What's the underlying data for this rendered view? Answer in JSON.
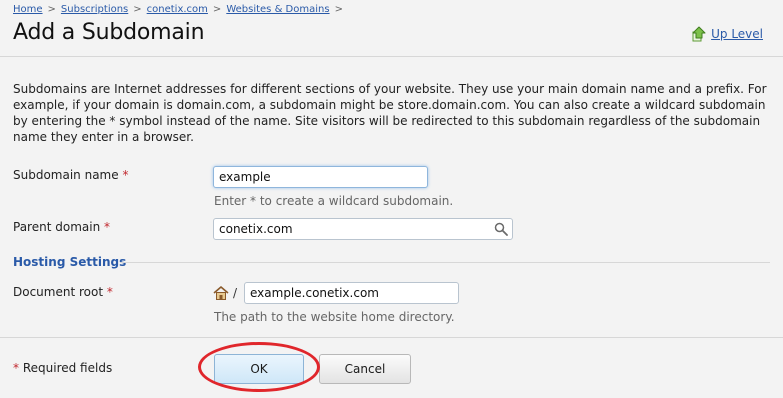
{
  "breadcrumb": {
    "items": [
      "Home",
      "Subscriptions",
      "conetix.com",
      "Websites & Domains"
    ],
    "separator": ">"
  },
  "page": {
    "title": "Add a Subdomain",
    "up_level": "Up Level"
  },
  "description": "Subdomains are Internet addresses for different sections of your website. They use your main domain name and a prefix. For example, if your domain is domain.com, a subdomain might be store.domain.com. You can also create a wildcard subdomain by entering the * symbol instead of the name. Site visitors will be redirected to this subdomain regardless of the subdomain name they enter in a browser.",
  "form": {
    "required_marker": "*",
    "subdomain_name": {
      "label": "Subdomain name",
      "value": "example",
      "hint": "Enter * to create a wildcard subdomain."
    },
    "parent_domain": {
      "label": "Parent domain",
      "value": "conetix.com"
    },
    "hosting_settings": {
      "title": "Hosting Settings"
    },
    "document_root": {
      "label": "Document root",
      "prefix": "/",
      "value": "example.conetix.com",
      "hint": "The path to the website home directory."
    }
  },
  "footer": {
    "required_fields": "Required fields",
    "ok_label": "OK",
    "cancel_label": "Cancel"
  },
  "colors": {
    "link": "#2a5aa8",
    "required": "#c0272d",
    "highlight": "#e0262b",
    "background": "#f3f3f3"
  },
  "icons": {
    "up_level": "up-level-icon",
    "search": "search-icon",
    "home": "home-icon"
  }
}
